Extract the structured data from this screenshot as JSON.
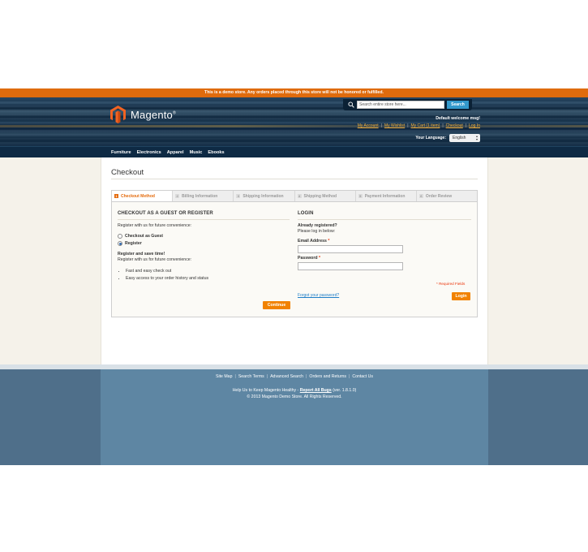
{
  "demo_notice": "This is a demo store. Any orders placed through this store will not be honored or fulfilled.",
  "header": {
    "logo_text": "Magento",
    "logo_reg": "®",
    "search": {
      "placeholder": "Search entire store here...",
      "button_label": "Search"
    },
    "welcome": "Default welcome msg!",
    "quick_links": [
      "My Account",
      "My Wishlist",
      "My Cart (1 item)",
      "Checkout",
      "Log In"
    ],
    "language_label": "Your Language:",
    "language_value": "English"
  },
  "nav": {
    "items": [
      "Furniture",
      "Electronics",
      "Apparel",
      "Music",
      "Ebooks"
    ]
  },
  "page_title": "Checkout",
  "steps": [
    {
      "num": "1",
      "label": "Checkout Method",
      "active": true
    },
    {
      "num": "2",
      "label": "Billing Information",
      "active": false
    },
    {
      "num": "3",
      "label": "Shipping Information",
      "active": false
    },
    {
      "num": "4",
      "label": "Shipping Method",
      "active": false
    },
    {
      "num": "5",
      "label": "Payment Information",
      "active": false
    },
    {
      "num": "6",
      "label": "Order Review",
      "active": false
    }
  ],
  "guest": {
    "title": "CHECKOUT AS A GUEST OR REGISTER",
    "intro": "Register with us for future convenience:",
    "options": [
      {
        "label": "Checkout as Guest",
        "checked": false
      },
      {
        "label": "Register",
        "checked": true
      }
    ],
    "save_time_title": "Register and save time!",
    "save_time_text": "Register with us for future convenience:",
    "bullets": [
      "Fast and easy check out",
      "Easy access to your order history and status"
    ],
    "continue_label": "Continue"
  },
  "login": {
    "title": "LOGIN",
    "already": "Already registered?",
    "please": "Please log in below:",
    "email_label": "Email Address",
    "password_label": "Password",
    "required_star": "*",
    "required_note": "* Required Fields",
    "forgot_label": "Forgot your password?",
    "login_label": "Login"
  },
  "footer": {
    "links": [
      "Site Map",
      "Search Terms",
      "Advanced Search",
      "Orders and Returns",
      "Contact Us"
    ],
    "help_prefix": "Help Us to Keep Magento Healthy - ",
    "help_link": "Report All Bugs",
    "help_suffix": " (ver. 1.8.1.0)",
    "copyright": "© 2013 Magento Demo Store. All Rights Reserved."
  },
  "colors": {
    "accent_orange": "#f18200",
    "notice_orange": "#df6b0d",
    "header_navy": "#0e2a44",
    "link_blue": "#1e7ec8",
    "required_red": "#eb340a",
    "footer_blue": "#5e86a3"
  }
}
